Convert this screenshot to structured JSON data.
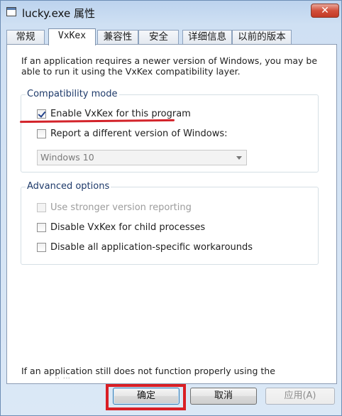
{
  "window": {
    "title": "lucky.exe 属性",
    "close_label": "✕"
  },
  "tabs": [
    {
      "label": "常规",
      "active": false
    },
    {
      "label": "VxKex",
      "active": true
    },
    {
      "label": "兼容性",
      "active": false
    },
    {
      "label": "安全",
      "active": false
    },
    {
      "label": "详细信息",
      "active": false
    },
    {
      "label": "以前的版本",
      "active": false
    }
  ],
  "panel": {
    "intro": "If an application requires a newer version of Windows, you may be able to run it using the VxKex compatibility layer.",
    "compat_group": {
      "title": "Compatibility mode",
      "enable": {
        "label": "Enable VxKex for this program",
        "checked": true
      },
      "report": {
        "label": "Report a different version of Windows:",
        "checked": false
      },
      "version_select": {
        "value": "Windows 10",
        "enabled": false
      }
    },
    "advanced_group": {
      "title": "Advanced options",
      "stronger": {
        "label": "Use stronger version reporting",
        "checked": false,
        "enabled": false
      },
      "child": {
        "label": "Disable VxKex for child processes",
        "checked": false
      },
      "workarounds": {
        "label": "Disable all application-specific workarounds",
        "checked": false
      }
    },
    "bottom_text_line1": "If an application still does not function properly using the compatibility"
  },
  "buttons": {
    "ok": "确定",
    "cancel": "取消",
    "apply": "应用(A)"
  },
  "annotation_color": "#d91f26"
}
